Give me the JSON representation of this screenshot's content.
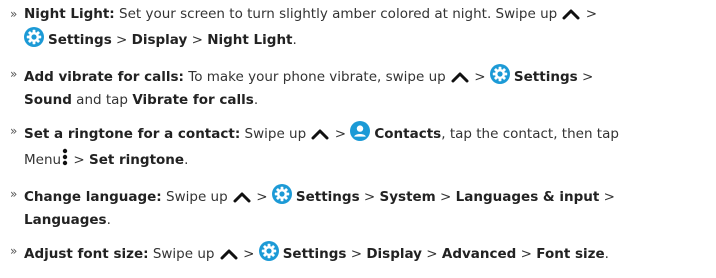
{
  "bullet_glyph": "»",
  "colors": {
    "accent": "#1c9ad6",
    "text": "#333333",
    "icon_dark": "#111111"
  },
  "icons": {
    "up": "chevron-up-icon",
    "settings": "settings-gear-icon",
    "contacts": "contacts-person-icon",
    "menu": "three-dot-menu-icon"
  },
  "items": [
    {
      "title": "Night Light:",
      "t1": " Set your screen to turn slightly amber colored at night. Swipe up ",
      "settings": "Settings",
      "gt": " > ",
      "p1": "Display",
      "p2": "Night Light",
      "end": "."
    },
    {
      "title": "Add vibrate for calls:",
      "t1": " To make your phone vibrate, swipe up ",
      "settings": "Settings",
      "gt": " > ",
      "p1": "Sound",
      "t2": " and tap ",
      "p2": "Vibrate for calls",
      "end": "."
    },
    {
      "title": "Set a ringtone for a contact:",
      "t1": " Swipe up ",
      "contacts": "Contacts",
      "t2": ", tap the contact, then tap",
      "menu": "Menu",
      "gt": " > ",
      "p1": "Set ringtone",
      "end": "."
    },
    {
      "title": "Change language:",
      "t1": " Swipe up ",
      "settings": "Settings",
      "gt": " > ",
      "p1": "System",
      "p2": "Languages & input",
      "p3": "Languages",
      "end": "."
    },
    {
      "title": "Adjust font size:",
      "t1": " Swipe up ",
      "settings": "Settings",
      "gt": " > ",
      "p1": "Display",
      "p2": "Advanced",
      "p3": "Font size",
      "end": "."
    }
  ]
}
